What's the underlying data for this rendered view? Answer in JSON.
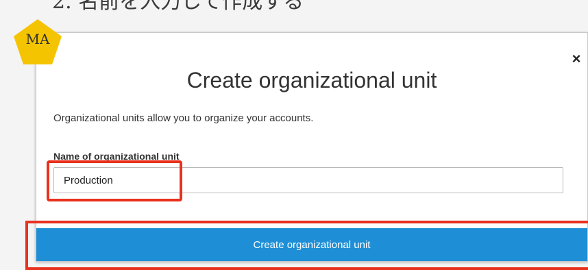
{
  "annotation": {
    "step_text": "2. 名前を入力して作成する",
    "badge_text": "MA",
    "badge_color": "#f5c400",
    "highlight_color": "#e8321e"
  },
  "modal": {
    "title": "Create organizational unit",
    "description": "Organizational units allow you to organize your accounts.",
    "field_label": "Name of organizational unit",
    "field_value": "Production",
    "submit_label": "Create organizational unit",
    "close_symbol": "×",
    "close_icon": "close-icon",
    "button_color": "#1e8fd6"
  }
}
